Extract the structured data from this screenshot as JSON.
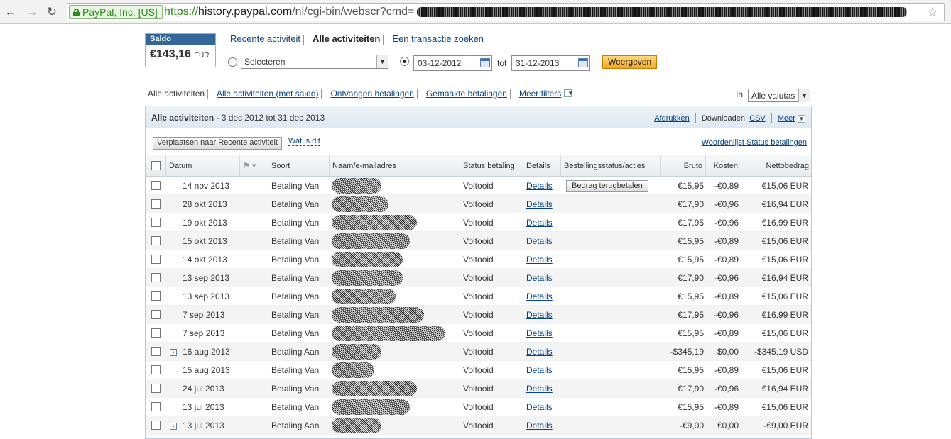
{
  "browser": {
    "ev_label": "PayPal, Inc. [US]",
    "url_scheme": "https://",
    "url_host": "history.paypal.com",
    "url_path": "/nl/cgi-bin/webscr?cmd="
  },
  "saldo": {
    "label": "Saldo",
    "amount": "€143,16",
    "currency": "EUR"
  },
  "top_tabs": [
    "Recente activiteit",
    "Alle activiteiten",
    "Een transactie zoeken"
  ],
  "filter": {
    "select_value": "Selecteren",
    "date_from": "03-12-2012",
    "to_label": "tot",
    "date_to": "31-12-2013",
    "show_button": "Weergeven"
  },
  "sub_tabs": [
    "Alle activiteiten",
    "Alle activiteiten (met saldo)",
    "Ontvangen betalingen",
    "Gemaakte betalingen",
    "Meer filters"
  ],
  "valuta": {
    "in_label": "In",
    "value": "Alle valutas"
  },
  "panel": {
    "title": "Alle activiteiten",
    "range": " - 3 dec 2012 tot 31 dec 2013",
    "print": "Afdrukken",
    "download_label": "Downloaden:",
    "csv": "CSV",
    "more": "Meer",
    "move_button": "Verplaatsen naar Recente activiteit",
    "what_is": "Wat is dit",
    "glossary": "Woordenlijst Status betalingen"
  },
  "columns": [
    "Datum",
    "Soort",
    "Naam/e-mailadres",
    "Status betaling",
    "Details",
    "Bestellingsstatus/acties",
    "Bruto",
    "Kosten",
    "Nettobedrag"
  ],
  "rows": [
    {
      "date": "14 nov 2013",
      "type": "Betaling Van",
      "status": "Voltooid",
      "details": "Details",
      "action": "Bedrag terugbetalen",
      "gross": "€15,95",
      "fee": "-€0,89",
      "net": "€15,06 EUR",
      "expand": false
    },
    {
      "date": "28 okt 2013",
      "type": "Betaling Van",
      "status": "Voltooid",
      "details": "Details",
      "action": "",
      "gross": "€17,90",
      "fee": "-€0,96",
      "net": "€16,94 EUR",
      "expand": false
    },
    {
      "date": "19 okt 2013",
      "type": "Betaling Van",
      "status": "Voltooid",
      "details": "Details",
      "action": "",
      "gross": "€17,95",
      "fee": "-€0,96",
      "net": "€16,99 EUR",
      "expand": false
    },
    {
      "date": "15 okt 2013",
      "type": "Betaling Van",
      "status": "Voltooid",
      "details": "Details",
      "action": "",
      "gross": "€15,95",
      "fee": "-€0,89",
      "net": "€15,06 EUR",
      "expand": false
    },
    {
      "date": "14 okt 2013",
      "type": "Betaling Van",
      "status": "Voltooid",
      "details": "Details",
      "action": "",
      "gross": "€15,95",
      "fee": "-€0,89",
      "net": "€15,06 EUR",
      "expand": false
    },
    {
      "date": "13 sep 2013",
      "type": "Betaling Van",
      "status": "Voltooid",
      "details": "Details",
      "action": "",
      "gross": "€17,90",
      "fee": "-€0,96",
      "net": "€16,94 EUR",
      "expand": false
    },
    {
      "date": "13 sep 2013",
      "type": "Betaling Van",
      "status": "Voltooid",
      "details": "Details",
      "action": "",
      "gross": "€15,95",
      "fee": "-€0,89",
      "net": "€15,06 EUR",
      "expand": false
    },
    {
      "date": "7 sep 2013",
      "type": "Betaling Van",
      "status": "Voltooid",
      "details": "Details",
      "action": "",
      "gross": "€17,95",
      "fee": "-€0,96",
      "net": "€16,99 EUR",
      "expand": false
    },
    {
      "date": "7 sep 2013",
      "type": "Betaling Van",
      "status": "Voltooid",
      "details": "Details",
      "action": "",
      "gross": "€15,95",
      "fee": "-€0,89",
      "net": "€15,06 EUR",
      "expand": false
    },
    {
      "date": "16 aug 2013",
      "type": "Betaling Aan",
      "status": "Voltooid",
      "details": "Details",
      "action": "",
      "gross": "-$345,19",
      "fee": "$0,00",
      "net": "-$345,19 USD",
      "expand": true
    },
    {
      "date": "15 aug 2013",
      "type": "Betaling Van",
      "status": "Voltooid",
      "details": "Details",
      "action": "",
      "gross": "€15,95",
      "fee": "-€0,89",
      "net": "€15,06 EUR",
      "expand": false
    },
    {
      "date": "24 jul 2013",
      "type": "Betaling Van",
      "status": "Voltooid",
      "details": "Details",
      "action": "",
      "gross": "€17,90",
      "fee": "-€0,96",
      "net": "€16,94 EUR",
      "expand": false
    },
    {
      "date": "13 jul 2013",
      "type": "Betaling Van",
      "status": "Voltooid",
      "details": "Details",
      "action": "",
      "gross": "€15,95",
      "fee": "-€0,89",
      "net": "€15,06 EUR",
      "expand": false
    },
    {
      "date": "13 jul 2013",
      "type": "Betaling Aan",
      "status": "Voltooid",
      "details": "Details",
      "action": "",
      "gross": "-€9,00",
      "fee": "€0,00",
      "net": "-€9,00 EUR",
      "expand": true
    }
  ]
}
